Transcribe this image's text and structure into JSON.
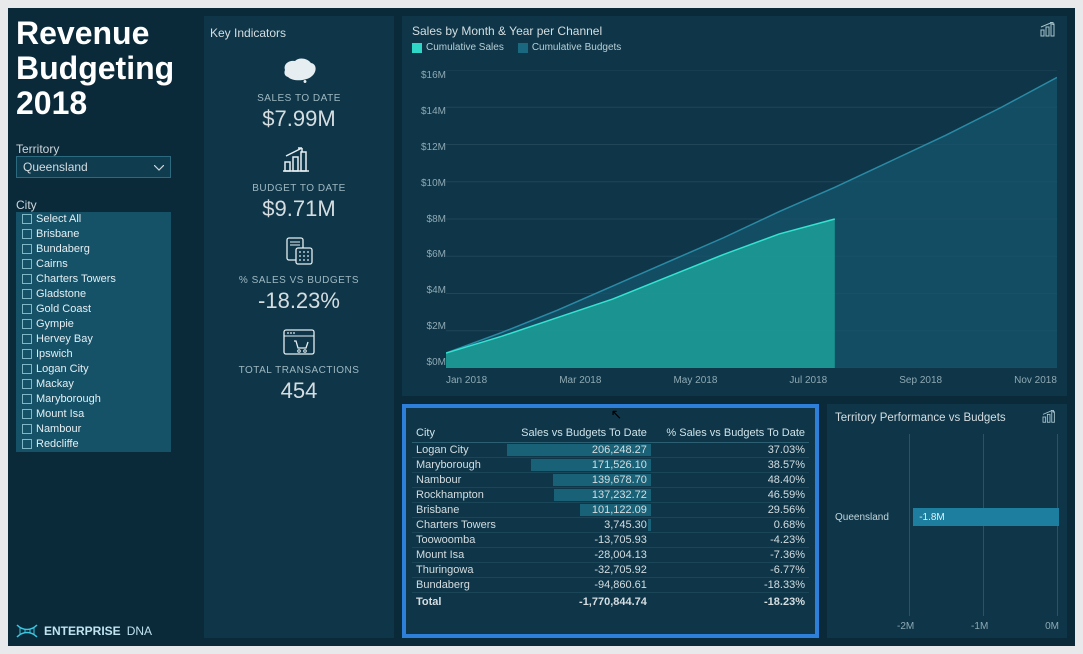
{
  "title_lines": [
    "Revenue",
    "Budgeting",
    "2018"
  ],
  "territory": {
    "label": "Territory",
    "selected": "Queensland"
  },
  "city_filter": {
    "label": "City",
    "items": [
      "Select All",
      "Brisbane",
      "Bundaberg",
      "Cairns",
      "Charters Towers",
      "Gladstone",
      "Gold Coast",
      "Gympie",
      "Hervey Bay",
      "Ipswich",
      "Logan City",
      "Mackay",
      "Maryborough",
      "Mount Isa",
      "Nambour",
      "Redcliffe"
    ]
  },
  "logo": {
    "brand1": "ENTERPRISE",
    "brand2": "DNA"
  },
  "indicators": {
    "panel_title": "Key Indicators",
    "sales_to_date": {
      "label": "SALES TO DATE",
      "value": "$7.99M"
    },
    "budget_to_date": {
      "label": "BUDGET TO DATE",
      "value": "$9.71M"
    },
    "pct_sales_vs_budgets": {
      "label": "% SALES VS BUDGETS",
      "value": "-18.23%"
    },
    "total_transactions": {
      "label": "TOTAL TRANSACTIONS",
      "value": "454"
    }
  },
  "chart": {
    "title": "Sales by Month & Year per Channel",
    "legend": [
      "Cumulative Sales",
      "Cumulative Budgets"
    ],
    "y_ticks": [
      "$16M",
      "$14M",
      "$12M",
      "$10M",
      "$8M",
      "$6M",
      "$4M",
      "$2M",
      "$0M"
    ],
    "x_ticks": [
      "Jan 2018",
      "Mar 2018",
      "May 2018",
      "Jul 2018",
      "Sep 2018",
      "Nov 2018"
    ]
  },
  "chart_data": {
    "type": "area",
    "title": "Sales by Month & Year per Channel",
    "xlabel": "",
    "ylabel": "",
    "ylim": [
      0,
      16
    ],
    "y_unit": "M USD",
    "x": [
      "Jan 2018",
      "Feb 2018",
      "Mar 2018",
      "Apr 2018",
      "May 2018",
      "Jun 2018",
      "Jul 2018",
      "Aug 2018",
      "Sep 2018",
      "Oct 2018",
      "Nov 2018",
      "Dec 2018"
    ],
    "series": [
      {
        "name": "Cumulative Sales",
        "values": [
          0.8,
          1.7,
          2.7,
          3.7,
          4.9,
          6.1,
          7.2,
          8.0,
          null,
          null,
          null,
          null
        ]
      },
      {
        "name": "Cumulative Budgets",
        "values": [
          0.8,
          1.9,
          3.1,
          4.4,
          5.7,
          7.0,
          8.4,
          9.7,
          11.1,
          12.5,
          14.0,
          15.6
        ]
      }
    ]
  },
  "perf_table": {
    "columns": [
      "City",
      "Sales vs Budgets To Date",
      "% Sales vs Budgets To Date"
    ],
    "rows": [
      {
        "city": "Logan City",
        "val": "206,248.27",
        "pct": "37.03%",
        "bar": 100
      },
      {
        "city": "Maryborough",
        "val": "171,526.10",
        "pct": "38.57%",
        "bar": 83
      },
      {
        "city": "Nambour",
        "val": "139,678.70",
        "pct": "48.40%",
        "bar": 68
      },
      {
        "city": "Rockhampton",
        "val": "137,232.72",
        "pct": "46.59%",
        "bar": 67
      },
      {
        "city": "Brisbane",
        "val": "101,122.09",
        "pct": "29.56%",
        "bar": 49
      },
      {
        "city": "Charters Towers",
        "val": "3,745.30",
        "pct": "0.68%",
        "bar": 2
      },
      {
        "city": "Toowoomba",
        "val": "-13,705.93",
        "pct": "-4.23%",
        "bar": 0
      },
      {
        "city": "Mount Isa",
        "val": "-28,004.13",
        "pct": "-7.36%",
        "bar": 0
      },
      {
        "city": "Thuringowa",
        "val": "-32,705.92",
        "pct": "-6.77%",
        "bar": 0
      },
      {
        "city": "Bundaberg",
        "val": "-94,860.61",
        "pct": "-18.33%",
        "bar": 0
      }
    ],
    "total": {
      "label": "Total",
      "val": "-1,770,844.74",
      "pct": "-18.23%"
    }
  },
  "territory_panel": {
    "title": "Territory Performance vs Budgets",
    "row": {
      "label": "Queensland",
      "value_label": "-1.8M",
      "value_millions": -1.8
    },
    "x_ticks": [
      "-2M",
      "-1M",
      "0M"
    ]
  }
}
